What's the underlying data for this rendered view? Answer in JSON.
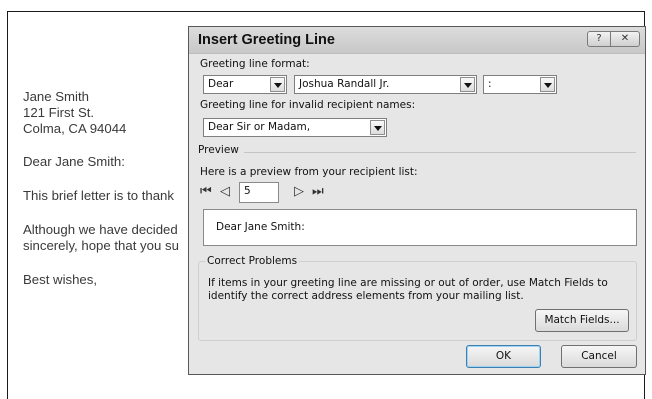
{
  "document": {
    "lines": [
      "Jane Smith",
      "121 First St.",
      "Colma, CA 94044",
      "Dear Jane Smith:",
      "This brief letter is to thank",
      "Although we have decided",
      "sincerely, hope that you su",
      "Best wishes,"
    ]
  },
  "dialog": {
    "title": "Insert Greeting Line",
    "help_button": "?",
    "close_button": "✕",
    "greeting_format_label": "Greeting line format:",
    "salutation": "Dear",
    "name_format": "Joshua Randall Jr.",
    "punctuation": ":",
    "invalid_label": "Greeting line for invalid recipient names:",
    "invalid_greeting": "Dear Sir or Madam,",
    "preview_label": "Preview",
    "preview_from_label": "Here is a preview from your recipient list:",
    "record_number": "5",
    "nav_first": "⏮",
    "nav_prev": "◁",
    "nav_next": "▷",
    "nav_last": "⏭",
    "preview_text": "Dear Jane Smith:",
    "correct_problems_label": "Correct Problems",
    "correct_problems_text": "If items in your greeting line are missing or out of order, use Match Fields to identify the correct address elements from your mailing list.",
    "match_fields_button": "Match Fields...",
    "ok_button": "OK",
    "cancel_button": "Cancel"
  }
}
